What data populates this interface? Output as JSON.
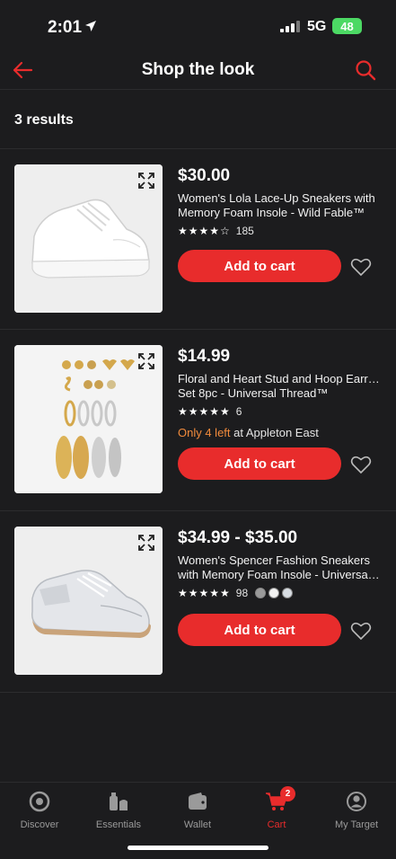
{
  "status_bar": {
    "time": "2:01",
    "network": "5G",
    "battery": "48"
  },
  "header": {
    "title": "Shop the look"
  },
  "results": {
    "count_label": "3 results"
  },
  "products": [
    {
      "price": "$30.00",
      "title_line1": "Women's Lola Lace-Up Sneakers with",
      "title_line2": "Memory Foam Insole - Wild Fable™",
      "stars": "★★★★☆",
      "review_count": "185",
      "rating": 4,
      "add_label": "Add to cart"
    },
    {
      "price": "$14.99",
      "title_line1": "Floral and Heart Stud and Hoop Earring",
      "title_line2": "Set 8pc - Universal Thread™",
      "stars": "★★★★★",
      "review_count": "6",
      "rating": 4.5,
      "stock_prefix": "Only 4 left",
      "stock_suffix": " at Appleton East",
      "add_label": "Add to cart"
    },
    {
      "price": "$34.99 - $35.00",
      "title_line1": "Women's Spencer Fashion Sneakers",
      "title_line2": "with Memory Foam Insole - Universal...",
      "stars": "★★★★★",
      "review_count": "98",
      "rating": 4.5,
      "swatch_colors": [
        "#9a9a9a",
        "#f2f2f2",
        "#d8dde3"
      ],
      "add_label": "Add to cart"
    }
  ],
  "tab_bar": {
    "tabs": [
      {
        "label": "Discover"
      },
      {
        "label": "Essentials"
      },
      {
        "label": "Wallet"
      },
      {
        "label": "Cart"
      },
      {
        "label": "My Target"
      }
    ],
    "cart_badge": "2"
  },
  "colors": {
    "accent": "#e82c2c",
    "background": "#1c1c1e",
    "low_stock": "#f08a3c"
  }
}
